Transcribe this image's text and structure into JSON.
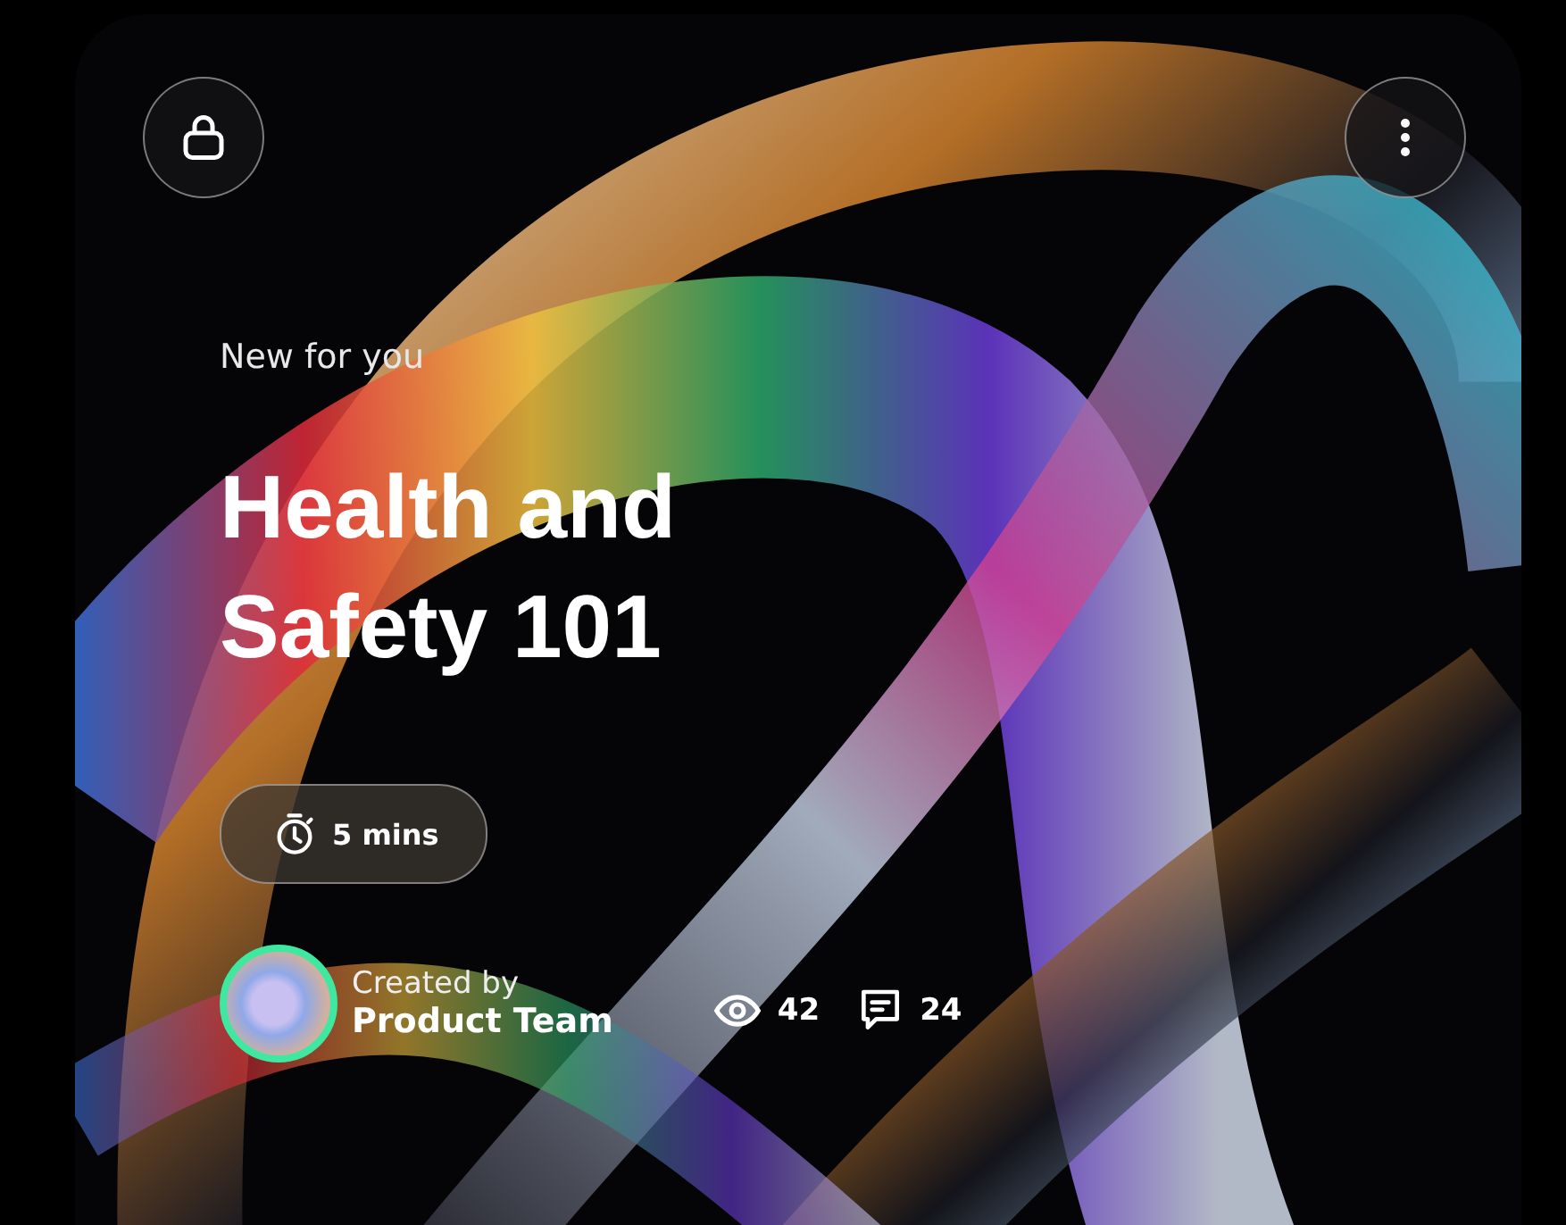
{
  "eyebrow": "New for you",
  "title": "Health and Safety 101",
  "duration": "5 mins",
  "author": {
    "label": "Created by",
    "name": "Product Team"
  },
  "stats": [
    {
      "kind": "views",
      "count": "42"
    },
    {
      "kind": "comments",
      "count": "24"
    }
  ]
}
